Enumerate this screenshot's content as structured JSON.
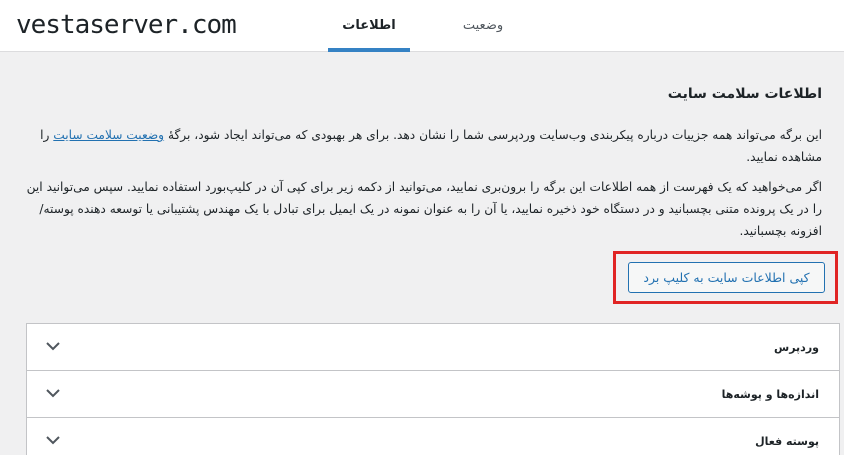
{
  "watermark": "vestaserver.com",
  "tabs": {
    "info": "اطلاعات",
    "status": "وضعیت"
  },
  "section": {
    "title": "اطلاعات سلامت سایت",
    "p1_text": "این برگه می‌تواند همه جزییات درباره پیکربندی وب‌سایت وردپرسی شما را نشان دهد. برای هر بهبودی که می‌تواند ایجاد شود، برگهٔ ",
    "p1_link": "وضعیت سلامت سایت",
    "p1_after": " را مشاهده نمایید.",
    "p2": "اگر می‌خواهید که یک فهرست از همه اطلاعات این برگه را برون‌بری نمایید، می‌توانید از دکمه زیر برای کپی آن در کلیپ‌بورد استفاده نمایید. سپس می‌توانید این را در یک پرونده متنی بچسبانید و در دستگاه خود ذخیره نمایید، یا آن را به عنوان نمونه در یک ایمیل برای تبادل با یک مهندس پشتیبانی یا توسعه دهنده پوسته/افزونه بچسبانید."
  },
  "copy_button": "کپی اطلاعات سایت به کلیپ برد",
  "accordion": [
    {
      "label": "وردپرس",
      "icon": "chevron-down-icon"
    },
    {
      "label": "اندازه‌ها و پوشه‌ها",
      "icon": "chevron-down-icon"
    },
    {
      "label": "پوسته فعال",
      "icon": "chevron-down-icon"
    }
  ],
  "colors": {
    "accent": "#2271b1",
    "tab_underline": "#3582c4",
    "highlight_box": "#e02424",
    "background": "#f0f0f1"
  }
}
